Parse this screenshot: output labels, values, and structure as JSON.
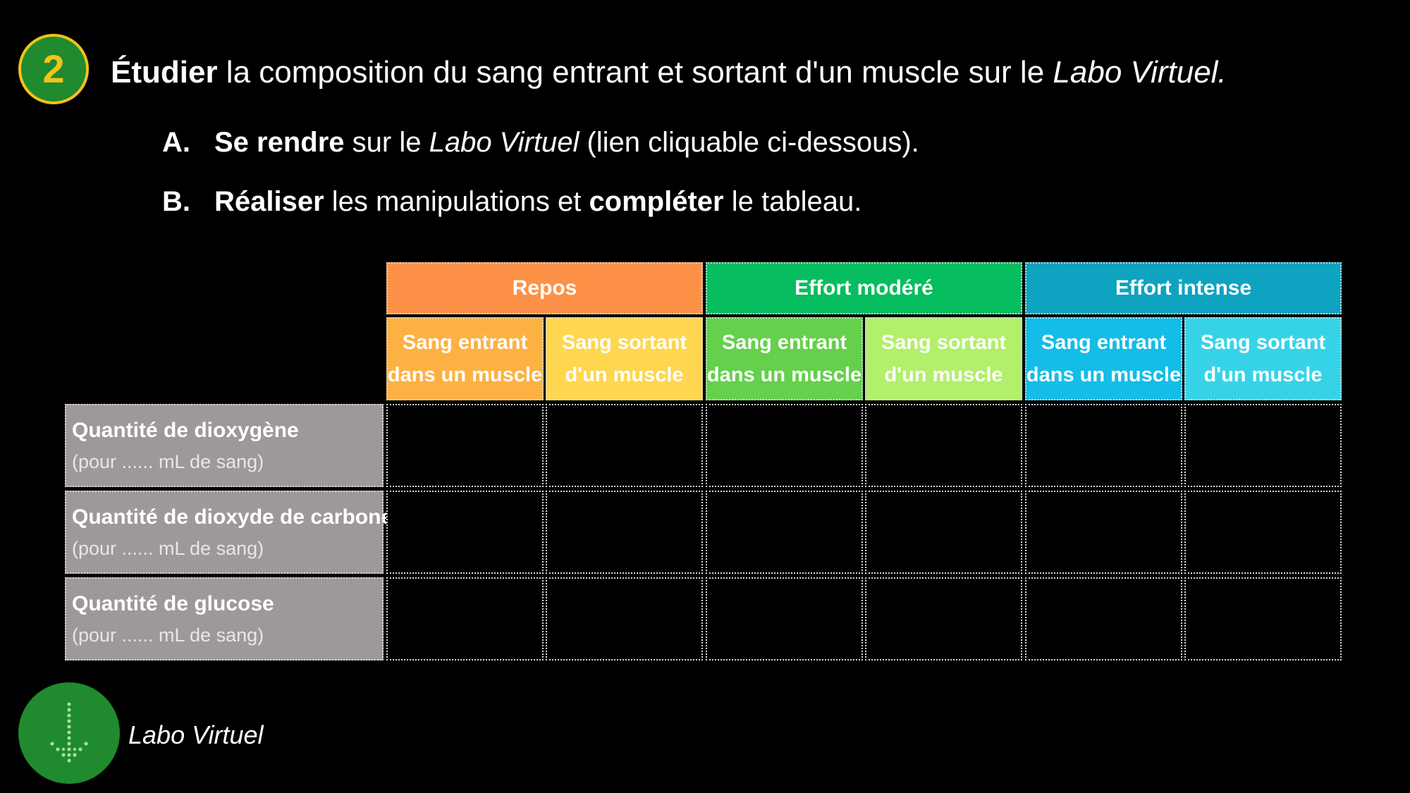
{
  "step": {
    "number": "2",
    "badge_color": "#1f8a2e",
    "badge_border": "#f2c318"
  },
  "title": {
    "verb": "Étudier",
    "text": " la composition du sang entrant et sortant d'un muscle sur le ",
    "italic": "Labo Virtuel."
  },
  "instructions": [
    {
      "marker": "A.",
      "bold1": "Se rendre",
      "text1": " sur le ",
      "italic1": "Labo Virtuel",
      "text2": " (lien cliquable ci-dessous)."
    },
    {
      "marker": "B.",
      "bold1": "Réaliser",
      "text1": " les manipulations et ",
      "bold2": "compléter",
      "text2": " le tableau."
    }
  ],
  "table": {
    "groups": [
      {
        "label": "Repos",
        "color": "#fe9148"
      },
      {
        "label": "Effort modéré",
        "color": "#06bd5f"
      },
      {
        "label": "Effort intense",
        "color": "#0ea3c0"
      }
    ],
    "subheaders": [
      {
        "line1": "Sang entrant",
        "line2": "dans un muscle",
        "color": "#fdb142"
      },
      {
        "line1": "Sang sortant",
        "line2": "d'un muscle",
        "color": "#fed64f"
      },
      {
        "line1": "Sang entrant",
        "line2": "dans un muscle",
        "color": "#64d04b"
      },
      {
        "line1": "Sang sortant",
        "line2": "d'un muscle",
        "color": "#b2ef6a"
      },
      {
        "line1": "Sang entrant",
        "line2": "dans un muscle",
        "color": "#13bde8"
      },
      {
        "line1": "Sang sortant",
        "line2": "d'un muscle",
        "color": "#36d3e8"
      }
    ],
    "rows": [
      {
        "title": "Quantité de dioxygène",
        "sub": "(pour ...... mL de sang)"
      },
      {
        "title": "Quantité de dioxyde de carbone",
        "sub": "(pour ...... mL de sang)"
      },
      {
        "title": "Quantité de glucose",
        "sub": "(pour ...... mL de sang)"
      }
    ],
    "row_header_color": "#9f9898"
  },
  "labo_link": {
    "label": "Labo Virtuel",
    "icon": "download-arrow-icon",
    "icon_color": "#1f8a2e"
  }
}
